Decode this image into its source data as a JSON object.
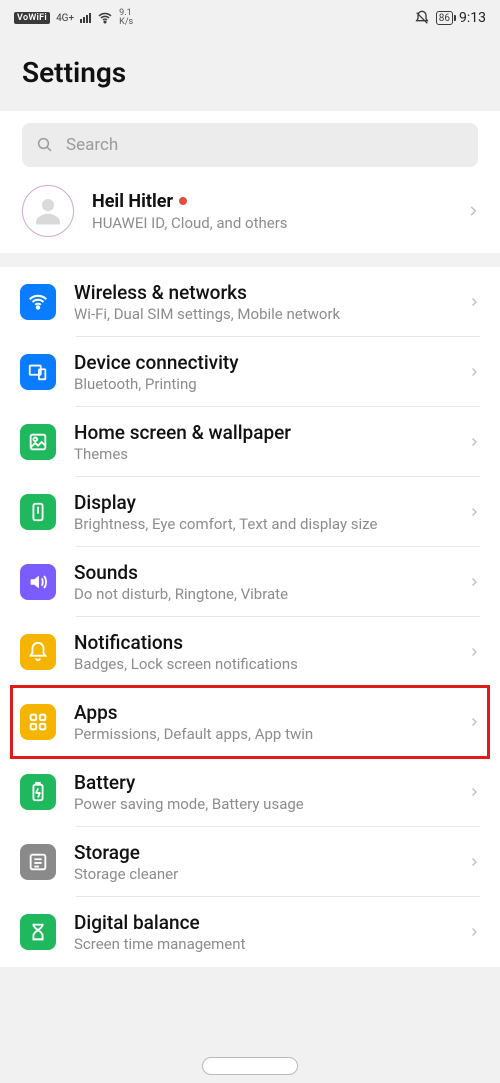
{
  "statusbar": {
    "vowifi": "VoWiFi",
    "netgen": "4G+",
    "speed_top": "9.1",
    "speed_bot": "K/s",
    "battery": "86",
    "time": "9:13"
  },
  "header": {
    "title": "Settings"
  },
  "search": {
    "placeholder": "Search"
  },
  "profile": {
    "name": "Heil Hitler",
    "subtitle": "HUAWEI ID, Cloud, and others"
  },
  "items": [
    {
      "icon": "wifi",
      "color": "ic-blue",
      "title": "Wireless & networks",
      "sub": "Wi-Fi, Dual SIM settings, Mobile network"
    },
    {
      "icon": "devconn",
      "color": "ic-blue2",
      "title": "Device connectivity",
      "sub": "Bluetooth, Printing"
    },
    {
      "icon": "home",
      "color": "ic-green",
      "title": "Home screen & wallpaper",
      "sub": "Themes"
    },
    {
      "icon": "display",
      "color": "ic-green2",
      "title": "Display",
      "sub": "Brightness, Eye comfort, Text and display size"
    },
    {
      "icon": "sound",
      "color": "ic-purple",
      "title": "Sounds",
      "sub": "Do not disturb, Ringtone, Vibrate"
    },
    {
      "icon": "notif",
      "color": "ic-amber",
      "title": "Notifications",
      "sub": "Badges, Lock screen notifications"
    },
    {
      "icon": "apps",
      "color": "ic-amber2",
      "title": "Apps",
      "sub": "Permissions, Default apps, App twin"
    },
    {
      "icon": "battery",
      "color": "ic-green3",
      "title": "Battery",
      "sub": "Power saving mode, Battery usage"
    },
    {
      "icon": "storage",
      "color": "ic-grey",
      "title": "Storage",
      "sub": "Storage cleaner"
    },
    {
      "icon": "digbal",
      "color": "ic-green4",
      "title": "Digital balance",
      "sub": "Screen time management"
    }
  ],
  "highlighted_index": 6
}
